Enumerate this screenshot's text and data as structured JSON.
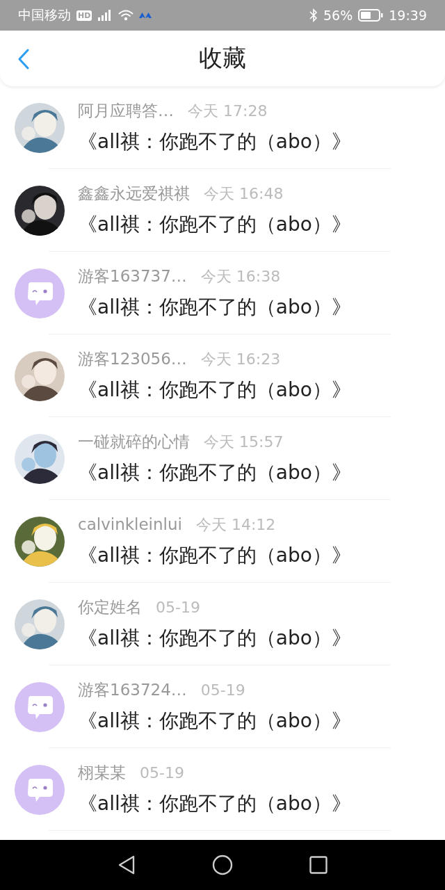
{
  "status_bar": {
    "carrier": "中国移动",
    "carrier_badge": "HD",
    "battery_percent": "56%",
    "time": "19:39"
  },
  "header": {
    "title": "收藏"
  },
  "items": [
    {
      "name": "阿月应聘答…",
      "time": "今天 17:28",
      "title": "《all祺：你跑不了的（abo）》"
    },
    {
      "name": "鑫鑫永远爱祺祺",
      "time": "今天 16:48",
      "title": "《all祺：你跑不了的（abo）》"
    },
    {
      "avatar": {
        "kind": "default"
      },
      "name": "游客163737…",
      "time": "今天 16:38",
      "title": "《all祺：你跑不了的（abo）》"
    },
    {
      "name": "游客123056…",
      "time": "今天 16:23",
      "title": "《all祺：你跑不了的（abo）》"
    },
    {
      "name": "一碰就碎的心情",
      "time": "今天 15:57",
      "title": "《all祺：你跑不了的（abo）》"
    },
    {
      "name": "calvinkleinlui",
      "time": "今天 14:12",
      "title": "《all祺：你跑不了的（abo）》"
    },
    {
      "name": "你定姓名",
      "time": "05-19",
      "title": "《all祺：你跑不了的（abo）》"
    },
    {
      "avatar": {
        "kind": "default"
      },
      "name": "游客163724…",
      "time": "05-19",
      "title": "《all祺：你跑不了的（abo）》"
    },
    {
      "avatar": {
        "kind": "default"
      },
      "name": "栩某某",
      "time": "05-19",
      "title": "《all祺：你跑不了的（abo）》"
    }
  ]
}
